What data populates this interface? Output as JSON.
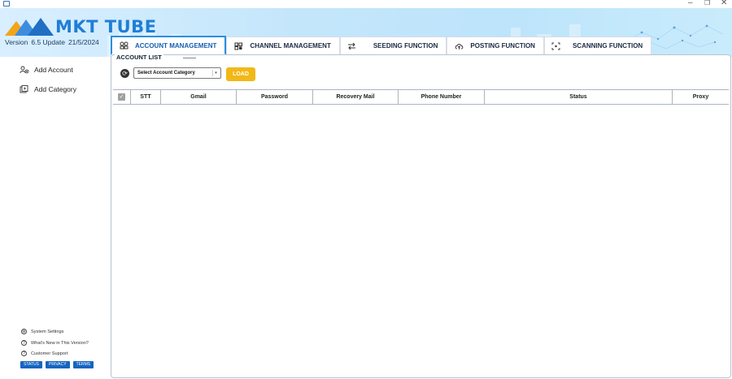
{
  "app": {
    "logo_text": "MKT TUBE",
    "version_label": "Version",
    "version_number": "6.5 Update",
    "version_date": "21/5/2024",
    "window_controls": {
      "minimize": "–",
      "restore": "❐",
      "close": "✕"
    },
    "colors": {
      "brand_blue": "#1f7ed6",
      "accent_yellow": "#f2b817",
      "active_tab_border": "#2a8fe0",
      "footer_button": "#1565c0"
    }
  },
  "tabs": [
    {
      "label": "ACCOUNT MANAGEMENT",
      "icon": "accounts-grid-icon",
      "active": true
    },
    {
      "label": "CHANNEL MANAGEMENT",
      "icon": "channels-grid-icon",
      "active": false
    },
    {
      "label": "SEEDING FUNCTION",
      "icon": "swap-arrows-icon",
      "active": false
    },
    {
      "label": "POSTING FUNCTION",
      "icon": "cloud-upload-icon",
      "active": false
    },
    {
      "label": "SCANNING FUNCTION",
      "icon": "scan-frame-icon",
      "active": false
    }
  ],
  "sidebar": {
    "items": [
      {
        "label": "Add Account",
        "icon": "add-user-icon"
      },
      {
        "label": "Add Category",
        "icon": "add-category-icon"
      }
    ],
    "footer_links": [
      {
        "label": "System Settings",
        "icon": "gear-icon"
      },
      {
        "label": "What's New in This Version?",
        "icon": "question-icon"
      },
      {
        "label": "Customer Support",
        "icon": "question-icon"
      }
    ],
    "footer_buttons": [
      "STATUS",
      "PRIVACY",
      "TERMS"
    ]
  },
  "main": {
    "section_title": "ACCOUNT LIST",
    "category_select": {
      "value": "Select Account Category",
      "icon": "refresh-icon"
    },
    "load_button": "LOAD",
    "table": {
      "columns": [
        "STT",
        "Gmail",
        "Password",
        "Recovery Mail",
        "Phone Number",
        "Status",
        "Proxy"
      ],
      "rows": []
    }
  }
}
